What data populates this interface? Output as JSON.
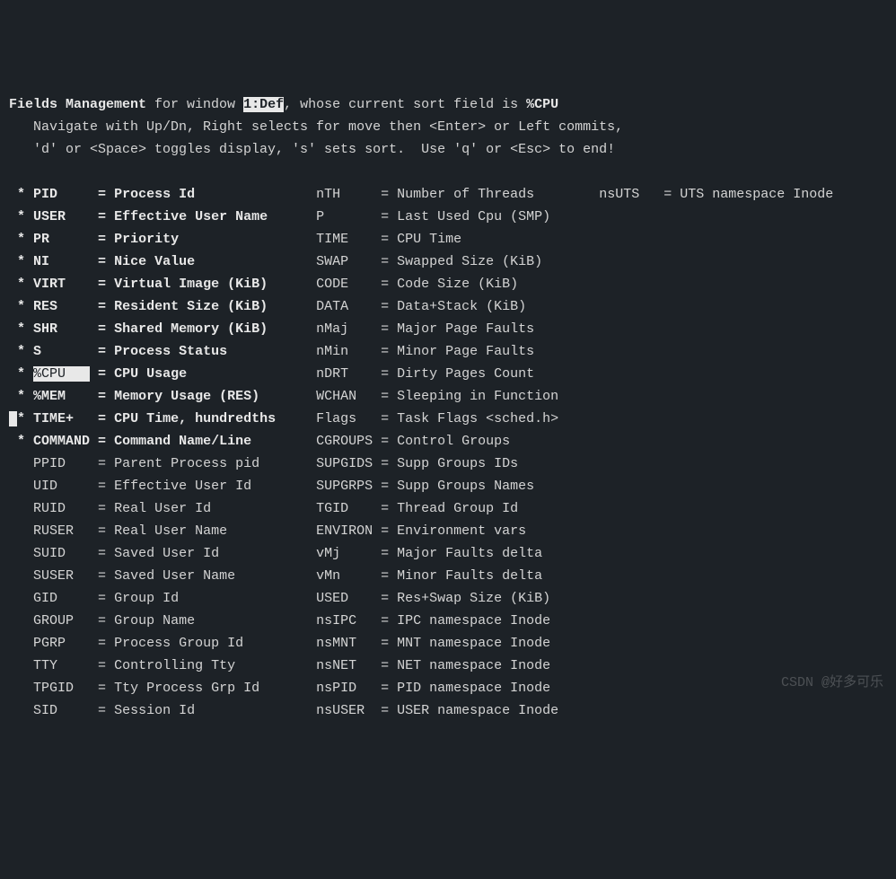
{
  "header": {
    "title": "Fields Management",
    "middle1": " for window ",
    "window_id": "1:Def",
    "middle2": ", whose current sort field is ",
    "sort_field": "%CPU",
    "nav_line": "   Navigate with Up/Dn, Right selects for move then <Enter> or Left commits,",
    "help_line": "   'd' or <Space> toggles display, 's' sets sort.  Use 'q' or <Esc> to end!"
  },
  "col1": [
    {
      "mark": "*",
      "cursor": false,
      "name": "PID",
      "eq": "=",
      "desc": "Process Id",
      "bold": true,
      "sel": false
    },
    {
      "mark": "*",
      "cursor": false,
      "name": "USER",
      "eq": "=",
      "desc": "Effective User Name",
      "bold": true,
      "sel": false
    },
    {
      "mark": "*",
      "cursor": false,
      "name": "PR",
      "eq": "=",
      "desc": "Priority",
      "bold": true,
      "sel": false
    },
    {
      "mark": "*",
      "cursor": false,
      "name": "NI",
      "eq": "=",
      "desc": "Nice Value",
      "bold": true,
      "sel": false
    },
    {
      "mark": "*",
      "cursor": false,
      "name": "VIRT",
      "eq": "=",
      "desc": "Virtual Image (KiB)",
      "bold": true,
      "sel": false
    },
    {
      "mark": "*",
      "cursor": false,
      "name": "RES",
      "eq": "=",
      "desc": "Resident Size (KiB)",
      "bold": true,
      "sel": false
    },
    {
      "mark": "*",
      "cursor": false,
      "name": "SHR",
      "eq": "=",
      "desc": "Shared Memory (KiB)",
      "bold": true,
      "sel": false
    },
    {
      "mark": "*",
      "cursor": false,
      "name": "S",
      "eq": "=",
      "desc": "Process Status",
      "bold": true,
      "sel": false
    },
    {
      "mark": "*",
      "cursor": false,
      "name": "%CPU",
      "eq": "=",
      "desc": "CPU Usage",
      "bold": true,
      "sel": true
    },
    {
      "mark": "*",
      "cursor": false,
      "name": "%MEM",
      "eq": "=",
      "desc": "Memory Usage (RES)",
      "bold": true,
      "sel": false
    },
    {
      "mark": "*",
      "cursor": true,
      "name": "TIME+",
      "eq": "=",
      "desc": "CPU Time, hundredths",
      "bold": true,
      "sel": false
    },
    {
      "mark": "*",
      "cursor": false,
      "name": "COMMAND",
      "eq": "=",
      "desc": "Command Name/Line",
      "bold": true,
      "sel": false
    },
    {
      "mark": " ",
      "cursor": false,
      "name": "PPID",
      "eq": "=",
      "desc": "Parent Process pid",
      "bold": false,
      "sel": false
    },
    {
      "mark": " ",
      "cursor": false,
      "name": "UID",
      "eq": "=",
      "desc": "Effective User Id",
      "bold": false,
      "sel": false
    },
    {
      "mark": " ",
      "cursor": false,
      "name": "RUID",
      "eq": "=",
      "desc": "Real User Id",
      "bold": false,
      "sel": false
    },
    {
      "mark": " ",
      "cursor": false,
      "name": "RUSER",
      "eq": "=",
      "desc": "Real User Name",
      "bold": false,
      "sel": false
    },
    {
      "mark": " ",
      "cursor": false,
      "name": "SUID",
      "eq": "=",
      "desc": "Saved User Id",
      "bold": false,
      "sel": false
    },
    {
      "mark": " ",
      "cursor": false,
      "name": "SUSER",
      "eq": "=",
      "desc": "Saved User Name",
      "bold": false,
      "sel": false
    },
    {
      "mark": " ",
      "cursor": false,
      "name": "GID",
      "eq": "=",
      "desc": "Group Id",
      "bold": false,
      "sel": false
    },
    {
      "mark": " ",
      "cursor": false,
      "name": "GROUP",
      "eq": "=",
      "desc": "Group Name",
      "bold": false,
      "sel": false
    },
    {
      "mark": " ",
      "cursor": false,
      "name": "PGRP",
      "eq": "=",
      "desc": "Process Group Id",
      "bold": false,
      "sel": false
    },
    {
      "mark": " ",
      "cursor": false,
      "name": "TTY",
      "eq": "=",
      "desc": "Controlling Tty",
      "bold": false,
      "sel": false
    },
    {
      "mark": " ",
      "cursor": false,
      "name": "TPGID",
      "eq": "=",
      "desc": "Tty Process Grp Id",
      "bold": false,
      "sel": false
    },
    {
      "mark": " ",
      "cursor": false,
      "name": "SID",
      "eq": "=",
      "desc": "Session Id",
      "bold": false,
      "sel": false
    }
  ],
  "col2": [
    {
      "mark": " ",
      "name": "nTH",
      "eq": "=",
      "desc": "Number of Threads"
    },
    {
      "mark": " ",
      "name": "P",
      "eq": "=",
      "desc": "Last Used Cpu (SMP)"
    },
    {
      "mark": " ",
      "name": "TIME",
      "eq": "=",
      "desc": "CPU Time"
    },
    {
      "mark": " ",
      "name": "SWAP",
      "eq": "=",
      "desc": "Swapped Size (KiB)"
    },
    {
      "mark": " ",
      "name": "CODE",
      "eq": "=",
      "desc": "Code Size (KiB)"
    },
    {
      "mark": " ",
      "name": "DATA",
      "eq": "=",
      "desc": "Data+Stack (KiB)"
    },
    {
      "mark": " ",
      "name": "nMaj",
      "eq": "=",
      "desc": "Major Page Faults"
    },
    {
      "mark": " ",
      "name": "nMin",
      "eq": "=",
      "desc": "Minor Page Faults"
    },
    {
      "mark": " ",
      "name": "nDRT",
      "eq": "=",
      "desc": "Dirty Pages Count"
    },
    {
      "mark": " ",
      "name": "WCHAN",
      "eq": "=",
      "desc": "Sleeping in Function"
    },
    {
      "mark": " ",
      "name": "Flags",
      "eq": "=",
      "desc": "Task Flags <sched.h>"
    },
    {
      "mark": " ",
      "name": "CGROUPS",
      "eq": "=",
      "desc": "Control Groups"
    },
    {
      "mark": " ",
      "name": "SUPGIDS",
      "eq": "=",
      "desc": "Supp Groups IDs"
    },
    {
      "mark": " ",
      "name": "SUPGRPS",
      "eq": "=",
      "desc": "Supp Groups Names"
    },
    {
      "mark": " ",
      "name": "TGID",
      "eq": "=",
      "desc": "Thread Group Id"
    },
    {
      "mark": " ",
      "name": "ENVIRON",
      "eq": "=",
      "desc": "Environment vars"
    },
    {
      "mark": " ",
      "name": "vMj",
      "eq": "=",
      "desc": "Major Faults delta"
    },
    {
      "mark": " ",
      "name": "vMn",
      "eq": "=",
      "desc": "Minor Faults delta"
    },
    {
      "mark": " ",
      "name": "USED",
      "eq": "=",
      "desc": "Res+Swap Size (KiB)"
    },
    {
      "mark": " ",
      "name": "nsIPC",
      "eq": "=",
      "desc": "IPC namespace Inode"
    },
    {
      "mark": " ",
      "name": "nsMNT",
      "eq": "=",
      "desc": "MNT namespace Inode"
    },
    {
      "mark": " ",
      "name": "nsNET",
      "eq": "=",
      "desc": "NET namespace Inode"
    },
    {
      "mark": " ",
      "name": "nsPID",
      "eq": "=",
      "desc": "PID namespace Inode"
    },
    {
      "mark": " ",
      "name": "nsUSER",
      "eq": "=",
      "desc": "USER namespace Inode"
    }
  ],
  "col3": [
    {
      "mark": " ",
      "name": "nsUTS",
      "eq": "=",
      "desc": "UTS namespace Inode"
    }
  ],
  "watermark": "CSDN @好多可乐"
}
